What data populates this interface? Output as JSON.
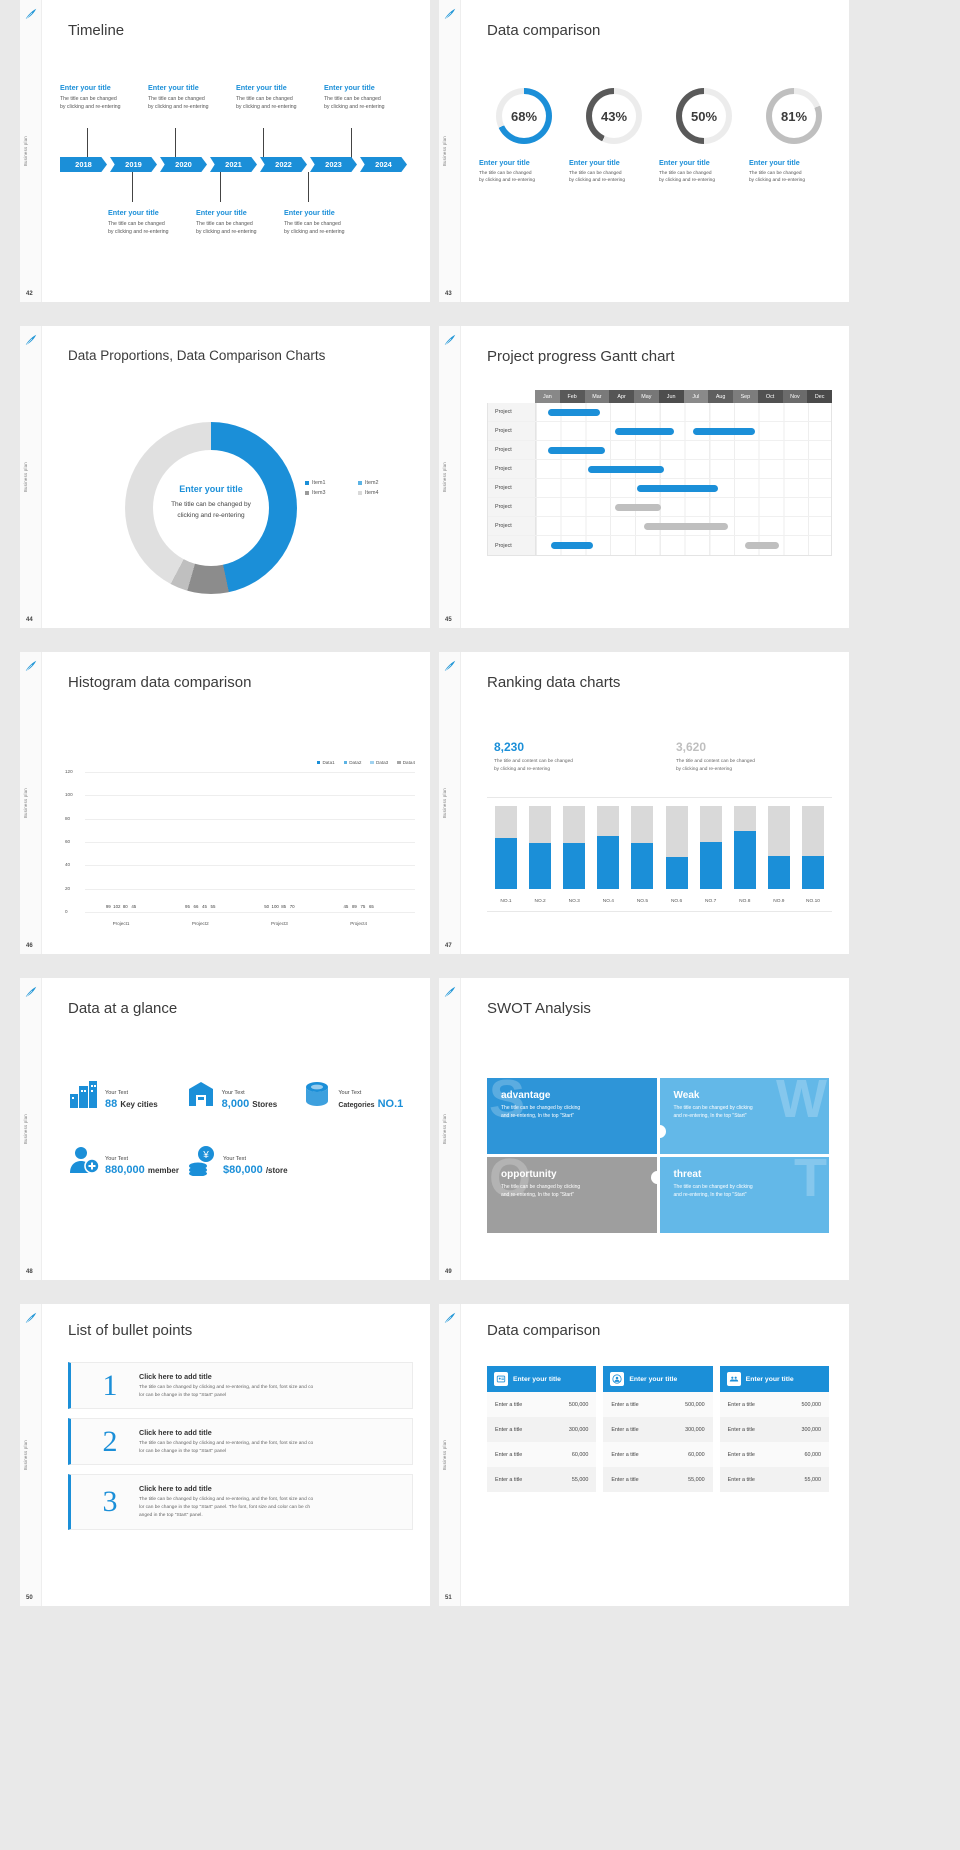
{
  "common": {
    "side_label": "Business plan",
    "logo_icon": "feather-logo-icon",
    "enter_title": "Enter your title",
    "body_line1": "The title can be changed",
    "body_line2": "by clicking and re-entering"
  },
  "slides": [
    {
      "page": "42",
      "title": "Timeline",
      "timeline": {
        "years": [
          "2018",
          "2019",
          "2020",
          "2021",
          "2022",
          "2023",
          "2024"
        ],
        "top_items": [
          {
            "title": "Enter your title",
            "l1": "The title can be changed",
            "l2": "by clicking and re-entering"
          },
          {
            "title": "Enter your title",
            "l1": "The title can be changed",
            "l2": "by clicking and re-entering"
          },
          {
            "title": "Enter your title",
            "l1": "The title can be changed",
            "l2": "by clicking and re-entering"
          },
          {
            "title": "Enter your title",
            "l1": "The title can be changed",
            "l2": "by clicking and re-entering"
          }
        ],
        "bottom_items": [
          {
            "title": "Enter your title",
            "l1": "The title can be changed",
            "l2": "by clicking and re-entering"
          },
          {
            "title": "Enter your title",
            "l1": "The title can be changed",
            "l2": "by clicking and re-entering"
          },
          {
            "title": "Enter your title",
            "l1": "The title can be changed",
            "l2": "by clicking and re-entering"
          }
        ]
      }
    },
    {
      "page": "43",
      "title": "Data comparison",
      "rings": [
        {
          "value": "68%",
          "percent": 68,
          "color": "#1b8fd8",
          "title": "Enter your title",
          "l1": "The title can be changed",
          "l2": "by clicking and re-entering"
        },
        {
          "value": "43%",
          "percent": 43,
          "color": "#595959",
          "title": "Enter your title",
          "l1": "The title can be changed",
          "l2": "by clicking and re-entering"
        },
        {
          "value": "50%",
          "percent": 50,
          "color": "#595959",
          "title": "Enter your title",
          "l1": "The title can be changed",
          "l2": "by clicking and re-entering"
        },
        {
          "value": "81%",
          "percent": 81,
          "color": "#bfbfbf",
          "title": "Enter your title",
          "l1": "The title can be changed",
          "l2": "by clicking and re-entering"
        }
      ]
    },
    {
      "page": "44",
      "title": "Data Proportions, Data Comparison Charts",
      "donut": {
        "center_title": "Enter your title",
        "center_l1": "The title can be changed by",
        "center_l2": "clicking and re-entering",
        "legend": [
          "Item1",
          "Item2",
          "Item3",
          "Item4"
        ],
        "legend_colors": [
          "#1b8fd8",
          "#5bb3e4",
          "#9a9a9a",
          "#d9d9d9"
        ]
      }
    },
    {
      "page": "45",
      "title": "Project progress Gantt chart",
      "gantt": {
        "months": [
          "Jan",
          "Feb",
          "Mar",
          "Apr",
          "May",
          "Jun",
          "Jul",
          "Aug",
          "Sep",
          "Oct",
          "Nov",
          "Dec"
        ],
        "rows": [
          {
            "label": "Project",
            "bars": [
              {
                "start": 0.5,
                "span": 2.1,
                "color": "#1b8fd8"
              }
            ]
          },
          {
            "label": "Project",
            "bars": [
              {
                "start": 3.2,
                "span": 2.4,
                "color": "#1b8fd8"
              },
              {
                "start": 6.4,
                "span": 2.5,
                "color": "#1b8fd8"
              }
            ]
          },
          {
            "label": "Project",
            "bars": [
              {
                "start": 0.5,
                "span": 2.3,
                "color": "#1b8fd8"
              }
            ]
          },
          {
            "label": "Project",
            "bars": [
              {
                "start": 2.1,
                "span": 3.1,
                "color": "#1b8fd8"
              }
            ]
          },
          {
            "label": "Project",
            "bars": [
              {
                "start": 4.1,
                "span": 3.3,
                "color": "#1b8fd8"
              }
            ]
          },
          {
            "label": "Project",
            "bars": [
              {
                "start": 3.2,
                "span": 1.9,
                "color": "#bfbfbf"
              }
            ]
          },
          {
            "label": "Project",
            "bars": [
              {
                "start": 4.4,
                "span": 3.4,
                "color": "#bfbfbf"
              }
            ]
          },
          {
            "label": "Project",
            "bars": [
              {
                "start": 0.6,
                "span": 1.7,
                "color": "#1b8fd8"
              },
              {
                "start": 8.5,
                "span": 1.4,
                "color": "#bfbfbf"
              }
            ]
          }
        ]
      }
    },
    {
      "page": "46",
      "title": "Histogram data comparison",
      "chart_data": {
        "type": "bar",
        "title": "Histogram data comparison",
        "categories": [
          "Project1",
          "Project2",
          "Project3",
          "Project4"
        ],
        "series": [
          {
            "name": "Data1",
            "color": "#1b8fd8",
            "values": [
              99,
              95,
              50,
              45
            ]
          },
          {
            "name": "Data2",
            "color": "#5bb3e4",
            "values": [
              102,
              66,
              100,
              89
            ]
          },
          {
            "name": "Data3",
            "color": "#9fd2f0",
            "values": [
              80,
              45,
              85,
              75
            ]
          },
          {
            "name": "Data4",
            "color": "#a6a6a6",
            "values": [
              45,
              55,
              70,
              65
            ]
          }
        ],
        "ylim": [
          0,
          120
        ],
        "yticks": [
          0,
          20,
          40,
          60,
          80,
          100,
          120
        ],
        "xlabel": "",
        "ylabel": "",
        "grid": true,
        "legend_position": "top-right"
      }
    },
    {
      "page": "47",
      "title": "Ranking data charts",
      "ranking": {
        "tops": [
          {
            "number": "8,230",
            "color": "#1b8fd8",
            "l1": "The title and content can be changed",
            "l2": "by clicking and re-entering"
          },
          {
            "number": "3,620",
            "color": "#bfbfbf",
            "l1": "The title and content can be changed",
            "l2": "by clicking and re-entering"
          }
        ],
        "chart_data": {
          "type": "bar",
          "categories": [
            "NO.1",
            "NO.2",
            "NO.3",
            "NO.4",
            "NO.5",
            "NO.6",
            "NO.7",
            "NO.8",
            "NO.9",
            "NO.10"
          ],
          "values": [
            62,
            55,
            55,
            64,
            55,
            38,
            57,
            70,
            40,
            40
          ],
          "ylim": [
            0,
            100
          ],
          "bar_color": "#1b8fd8",
          "track_color": "#d9d9d9",
          "grid": false
        }
      }
    },
    {
      "page": "48",
      "title": "Data at a glance",
      "glance": [
        {
          "icon": "city-buildings-icon",
          "label": "Your Text",
          "value": "88",
          "unit": "Key cities"
        },
        {
          "icon": "store-icon",
          "label": "Your Text",
          "value": "8,000",
          "unit": "Stores"
        },
        {
          "icon": "database-icon",
          "label": "Your Text",
          "value": "",
          "unit": "Categories",
          "suffix": "NO.1"
        },
        {
          "icon": "user-add-icon",
          "label": "Your Text",
          "value": "880,000",
          "unit": "member"
        },
        {
          "icon": "coins-yen-icon",
          "label": "Your Text",
          "value": "$80,000",
          "unit": "/store"
        }
      ]
    },
    {
      "page": "49",
      "title": "SWOT Analysis",
      "swot": [
        {
          "letter": "S",
          "heading": "advantage",
          "color": "#2e95d8",
          "l1": "The title can be changed by clicking",
          "l2": "and re-entering, In the top \"Start\""
        },
        {
          "letter": "W",
          "heading": "Weak",
          "color": "#63b8e8",
          "l1": "The title can be changed by clicking",
          "l2": "and re-entering, In the top \"Start\""
        },
        {
          "letter": "O",
          "heading": "opportunity",
          "color": "#9e9e9e",
          "l1": "The title can be changed by clicking",
          "l2": "and re-entering, In the top \"Start\""
        },
        {
          "letter": "T",
          "heading": "threat",
          "color": "#63b8e8",
          "l1": "The title can be changed by clicking",
          "l2": "and re-entering, In the top \"Start\""
        }
      ]
    },
    {
      "page": "50",
      "title": "List of bullet points",
      "bullets": [
        {
          "num": "1",
          "title": "Click here to add title",
          "l1": "The title can be changed by clicking and re-entering, and the font, font size and co",
          "l2": "lor can be change in the top \"Start\" panel"
        },
        {
          "num": "2",
          "title": "Click here to add title",
          "l1": "The title can be changed by clicking and re-entering, and the font, font size and co",
          "l2": "lor can be change in the top \"Start\" panel"
        },
        {
          "num": "3",
          "title": "Click here to add title",
          "l1": "The title can be changed by clicking and re-entering, and the font, font size and co",
          "l2": "lor can be change in the top \"Start\" panel. The font, font size and color can be ch",
          "l3": "anged in the top \"Start\" panel."
        }
      ]
    },
    {
      "page": "51",
      "title": "Data comparison",
      "comparison": {
        "columns": [
          {
            "icon": "id-card-icon",
            "header": "Enter your title"
          },
          {
            "icon": "user-circle-icon",
            "header": "Enter your title"
          },
          {
            "icon": "users-group-icon",
            "header": "Enter your title"
          }
        ],
        "rows": [
          {
            "label": "Enter a title",
            "values": [
              "500,000",
              "500,000",
              "500,000"
            ]
          },
          {
            "label": "Enter a title",
            "values": [
              "300,000",
              "300,000",
              "300,000"
            ]
          },
          {
            "label": "Enter a title",
            "values": [
              "60,000",
              "60,000",
              "60,000"
            ]
          },
          {
            "label": "Enter a title",
            "values": [
              "55,000",
              "55,000",
              "55,000"
            ]
          }
        ]
      }
    }
  ]
}
